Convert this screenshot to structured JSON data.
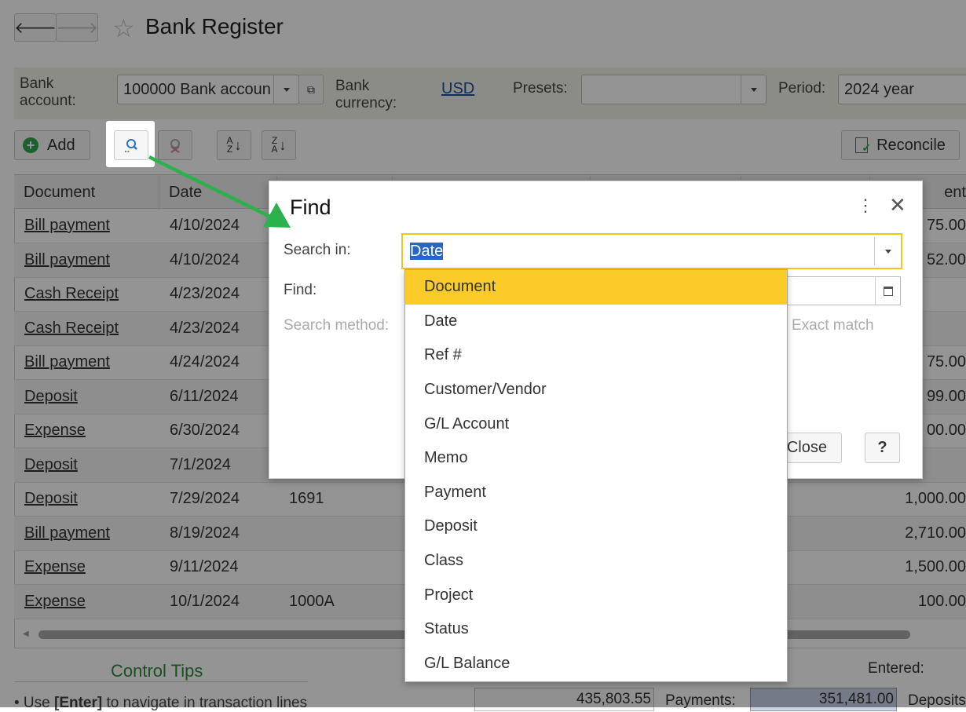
{
  "title": "Bank Register",
  "header": {
    "bank_account_label": "Bank account:",
    "bank_account_value": "100000 Bank accoun",
    "bank_currency_label": "Bank currency:",
    "bank_currency_value": "USD",
    "presets_label": "Presets:",
    "presets_value": "",
    "period_label": "Period:",
    "period_value": "2024 year"
  },
  "toolbar": {
    "add_label": "Add",
    "reconcile_label": "Reconcile"
  },
  "table": {
    "columns": [
      "Document",
      "Date",
      "",
      "",
      "",
      "",
      "ent"
    ],
    "rows": [
      {
        "doc": "Bill payment",
        "date": "4/10/2024",
        "ref": "",
        "amount": "75.00"
      },
      {
        "doc": "Bill payment",
        "date": "4/10/2024",
        "ref": "",
        "amount": "52.00"
      },
      {
        "doc": "Cash Receipt",
        "date": "4/23/2024",
        "ref": "",
        "amount": ""
      },
      {
        "doc": "Cash Receipt",
        "date": "4/23/2024",
        "ref": "",
        "amount": ""
      },
      {
        "doc": "Bill payment",
        "date": "4/24/2024",
        "ref": "",
        "amount": "75.00"
      },
      {
        "doc": "Deposit",
        "date": "6/11/2024",
        "ref": "",
        "amount": "99.00"
      },
      {
        "doc": "Expense",
        "date": "6/30/2024",
        "ref": "",
        "amount": "00.00"
      },
      {
        "doc": "Deposit",
        "date": "7/1/2024",
        "ref": "",
        "amount": ""
      },
      {
        "doc": "Deposit",
        "date": "7/29/2024",
        "ref": "1691",
        "amount": "1,000.00"
      },
      {
        "doc": "Bill payment",
        "date": "8/19/2024",
        "ref": "",
        "amount": "2,710.00"
      },
      {
        "doc": "Expense",
        "date": "9/11/2024",
        "ref": "",
        "amount": "1,500.00"
      },
      {
        "doc": "Expense",
        "date": "10/1/2024",
        "ref": "1000A",
        "amount": "100.00"
      }
    ]
  },
  "footer": {
    "control_tips": "Control Tips",
    "tip_prefix": "• Use ",
    "tip_key": "[Enter]",
    "tip_suffix": " to navigate in transaction lines",
    "entered_label": "Entered:",
    "total_value": "435,803.55",
    "payments_label": "Payments:",
    "payments_value": "351,481.00",
    "deposits_label": "Deposits"
  },
  "find_dialog": {
    "title": "Find",
    "search_in_label": "Search in:",
    "search_in_value": "Date",
    "find_label": "Find:",
    "search_method_label": "Search method:",
    "exact_match_label": "Exact match",
    "close_label": "Close",
    "help_label": "?"
  },
  "dropdown": {
    "options": [
      "Document",
      "Date",
      "Ref #",
      "Customer/Vendor",
      "G/L Account",
      "Memo",
      "Payment",
      "Deposit",
      "Class",
      "Project",
      "Status",
      "G/L Balance"
    ],
    "selected_index": 0
  },
  "colors": {
    "accent": "#fbcc29",
    "arrow": "#2bb24c",
    "add_icon": "#2fa84f"
  }
}
